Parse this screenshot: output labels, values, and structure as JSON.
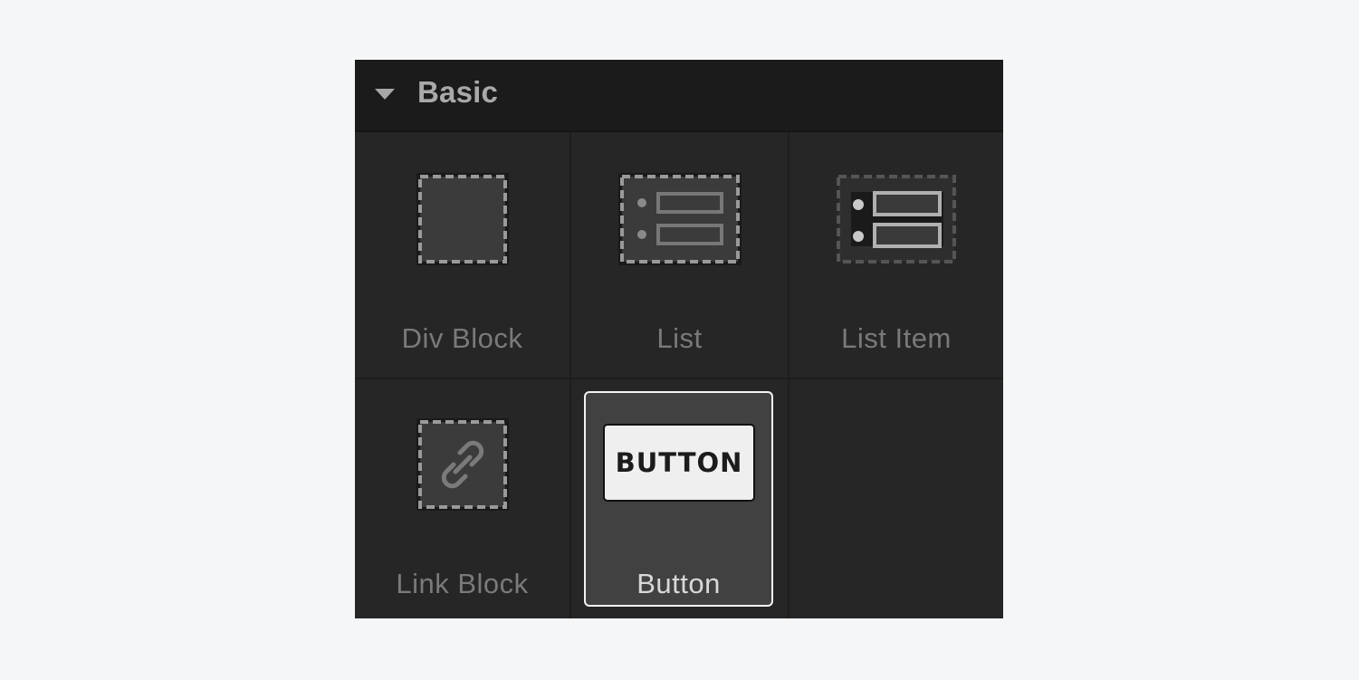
{
  "panel": {
    "title": "Basic",
    "collapse_icon": "caret-down-icon"
  },
  "elements": [
    {
      "label": "Div Block",
      "icon": "div-block-icon"
    },
    {
      "label": "List",
      "icon": "list-icon"
    },
    {
      "label": "List Item",
      "icon": "list-item-icon"
    },
    {
      "label": "Link Block",
      "icon": "link-block-icon"
    },
    {
      "label": "Button",
      "icon": "button-icon",
      "preview_text": "BUTTON",
      "selected": true
    }
  ],
  "colors": {
    "page_background": "#f5f6f8",
    "panel_background": "#262626",
    "header_background": "#1b1b1b",
    "selected_background": "#414141",
    "selected_border": "#f2f2f2"
  }
}
